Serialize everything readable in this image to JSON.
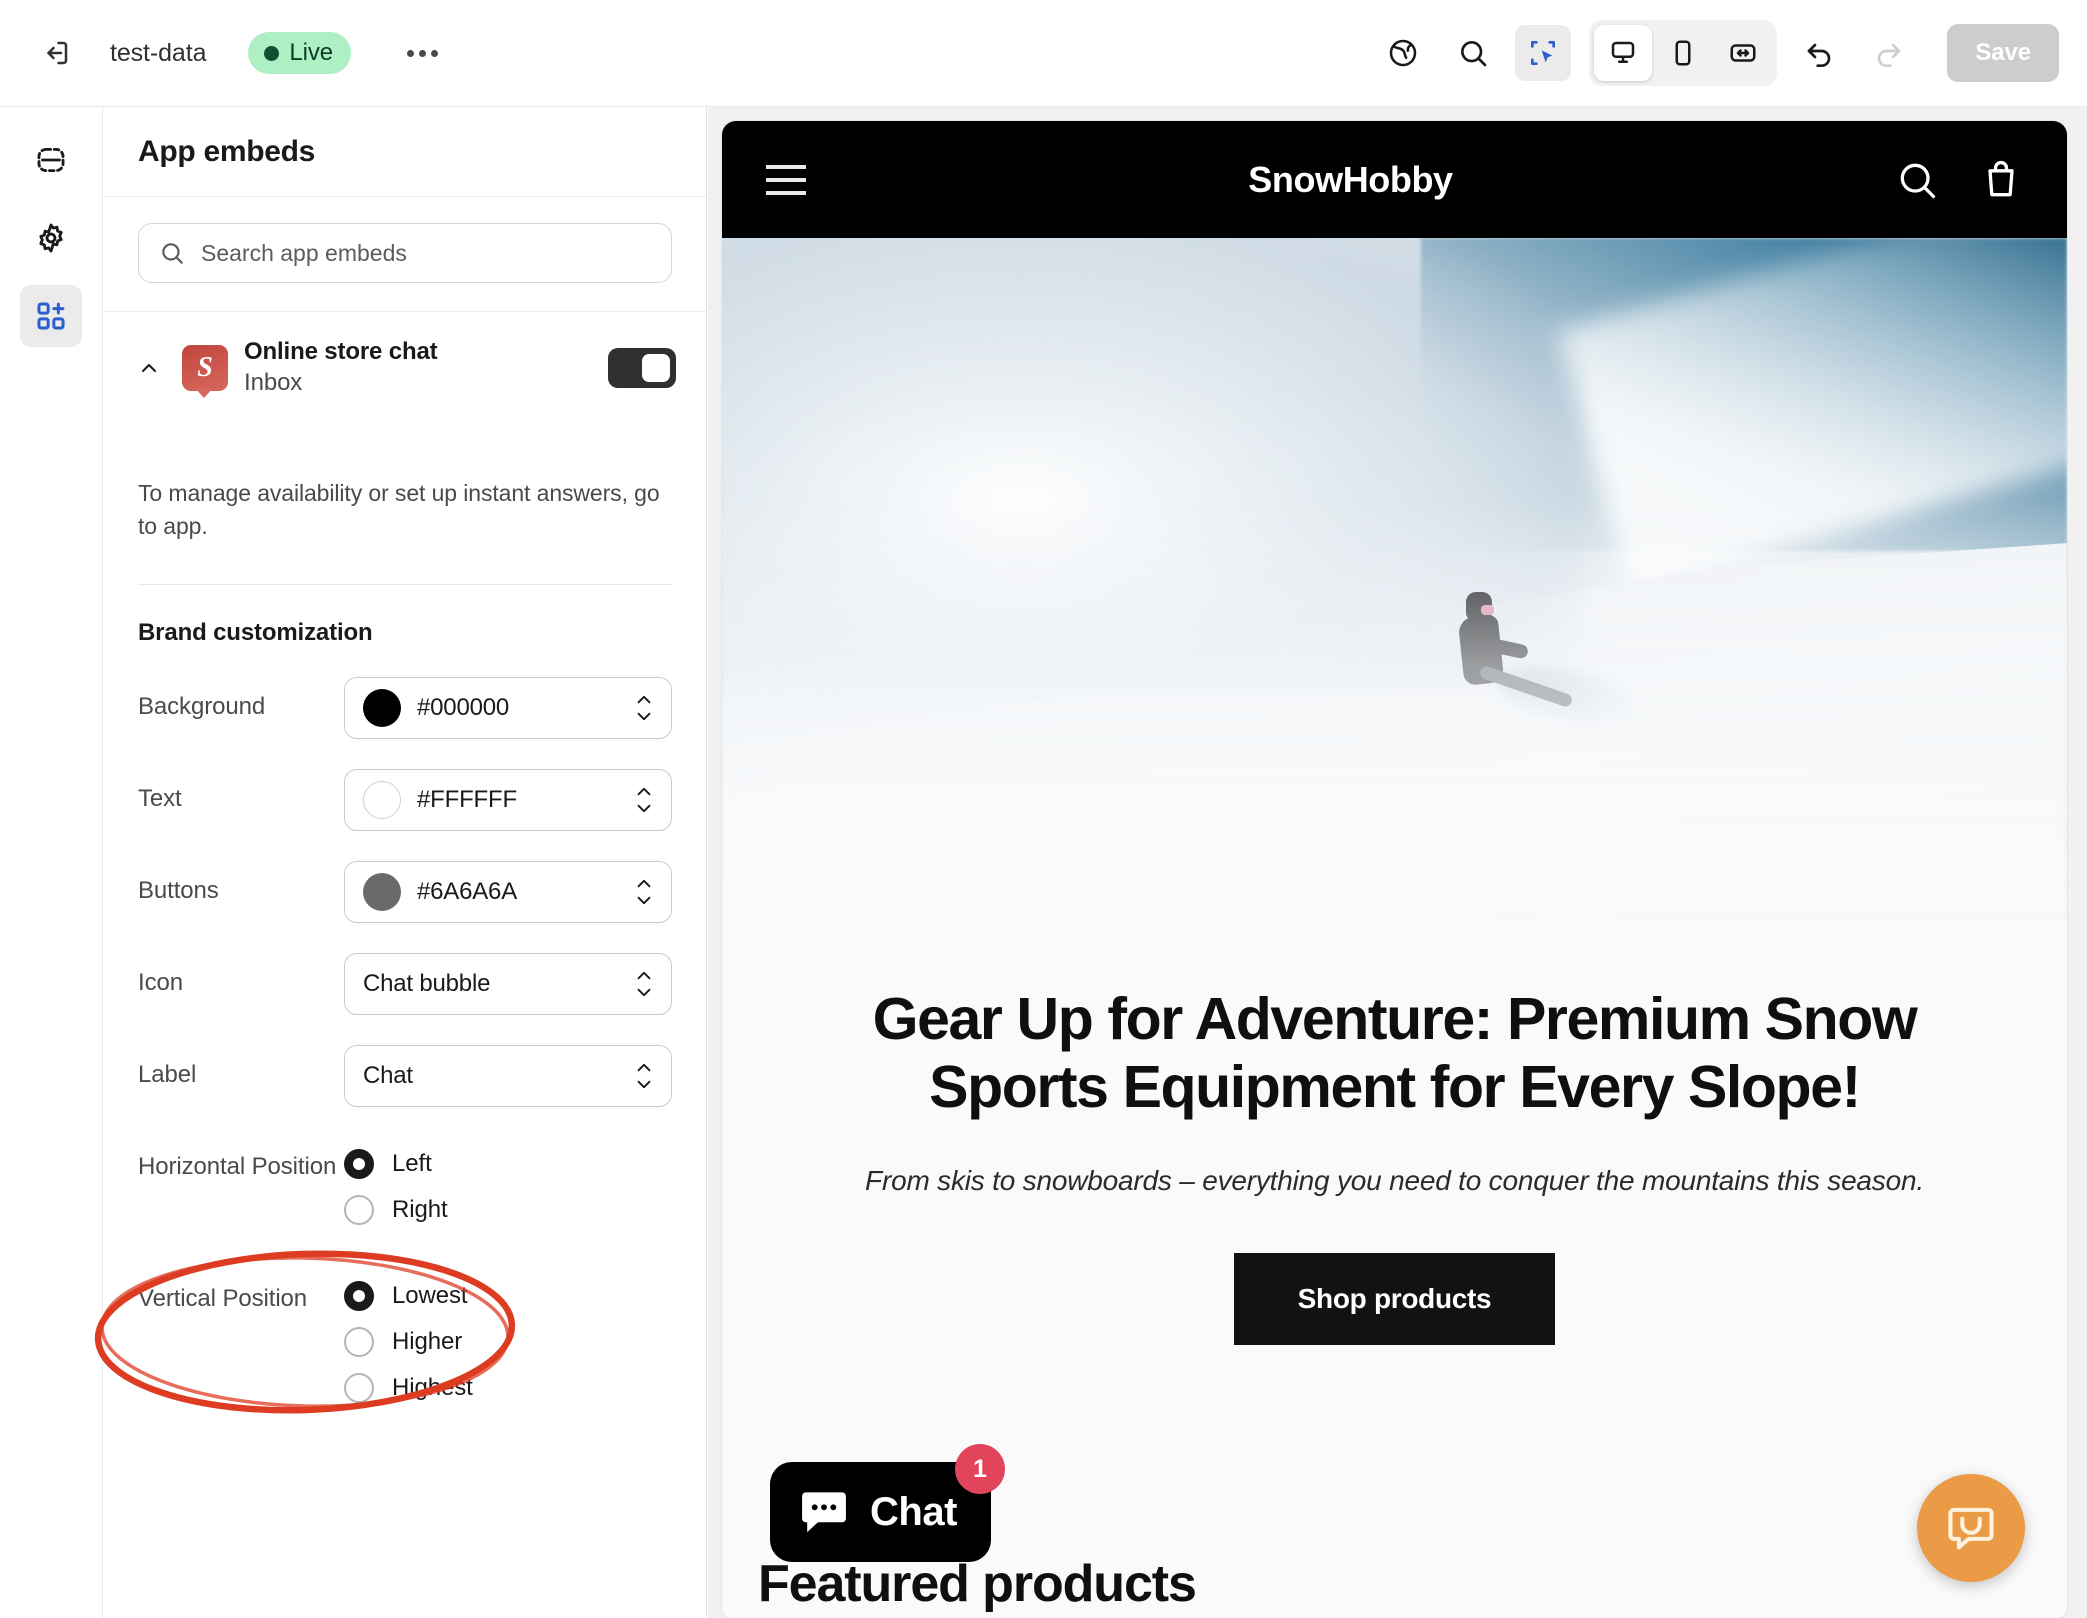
{
  "topbar": {
    "exit_icon": "exit-icon",
    "store_name": "test-data",
    "status_badge": "Live",
    "more_icon": "ellipsis-icon",
    "globe_icon": "globe-icon",
    "search_icon": "search-icon",
    "inspector_icon": "inspector-icon",
    "desktop_icon": "desktop-icon",
    "mobile_icon": "mobile-icon",
    "fullwidth_icon": "fullwidth-icon",
    "undo_icon": "undo-icon",
    "redo_icon": "redo-icon",
    "save_label": "Save",
    "accent_blue": "#2c5ecf",
    "badge_bg": "#afefc4",
    "badge_fg": "#0c3b27"
  },
  "rail": {
    "items": [
      {
        "name": "sections-icon",
        "label": "Sections",
        "active": false
      },
      {
        "name": "settings-icon",
        "label": "Settings",
        "active": false
      },
      {
        "name": "app-embeds-icon",
        "label": "App embeds",
        "active": true
      }
    ]
  },
  "panel": {
    "title": "App embeds",
    "search": {
      "placeholder": "Search app embeds",
      "value": "",
      "icon": "search-icon"
    },
    "embed": {
      "collapse_icon": "chevron-up-icon",
      "app_icon_letter": "S",
      "title": "Online store chat",
      "subtitle": "Inbox",
      "toggle_on": true
    },
    "helper_text": "To manage availability or set up instant answers, go to app.",
    "section_title": "Brand customization",
    "fields": [
      {
        "label": "Background",
        "value": "#000000",
        "swatch": "#000000",
        "type": "color"
      },
      {
        "label": "Text",
        "value": "#FFFFFF",
        "swatch": "#FFFFFF",
        "type": "color"
      },
      {
        "label": "Buttons",
        "value": "#6A6A6A",
        "swatch": "#6A6A6A",
        "type": "color"
      },
      {
        "label": "Icon",
        "value": "Chat bubble",
        "type": "select"
      },
      {
        "label": "Label",
        "value": "Chat",
        "type": "select"
      }
    ],
    "horizontal_position": {
      "label": "Horizontal Position",
      "options": [
        {
          "label": "Left",
          "selected": true
        },
        {
          "label": "Right",
          "selected": false
        }
      ]
    },
    "vertical_position": {
      "label": "Vertical Position",
      "options": [
        {
          "label": "Lowest",
          "selected": true
        },
        {
          "label": "Higher",
          "selected": false
        },
        {
          "label": "Highest",
          "selected": false
        }
      ]
    },
    "annotation_color": "#dd3c22"
  },
  "preview": {
    "store_header": {
      "menu_icon": "hamburger-menu-icon",
      "logo": "SnowHobby",
      "search_icon": "search-icon",
      "cart_icon": "cart-icon"
    },
    "hero_image_alt": "snowboarder-riding-powder-snow",
    "hero_title": "Gear Up for Adventure: Premium Snow Sports Equipment for Every Slope!",
    "hero_subtitle": "From skis to snowboards – everything you need to conquer the mountains this season.",
    "cta_label": "Shop products",
    "featured_title": "Featured products",
    "chat_widget": {
      "label": "Chat",
      "badge": "1",
      "icon": "chat-bubble-icon",
      "bg": "#000000",
      "badge_bg": "#e2445c"
    },
    "tidio_widget": {
      "icon": "smiley-chat-icon",
      "bg": "#eb9b45"
    }
  }
}
